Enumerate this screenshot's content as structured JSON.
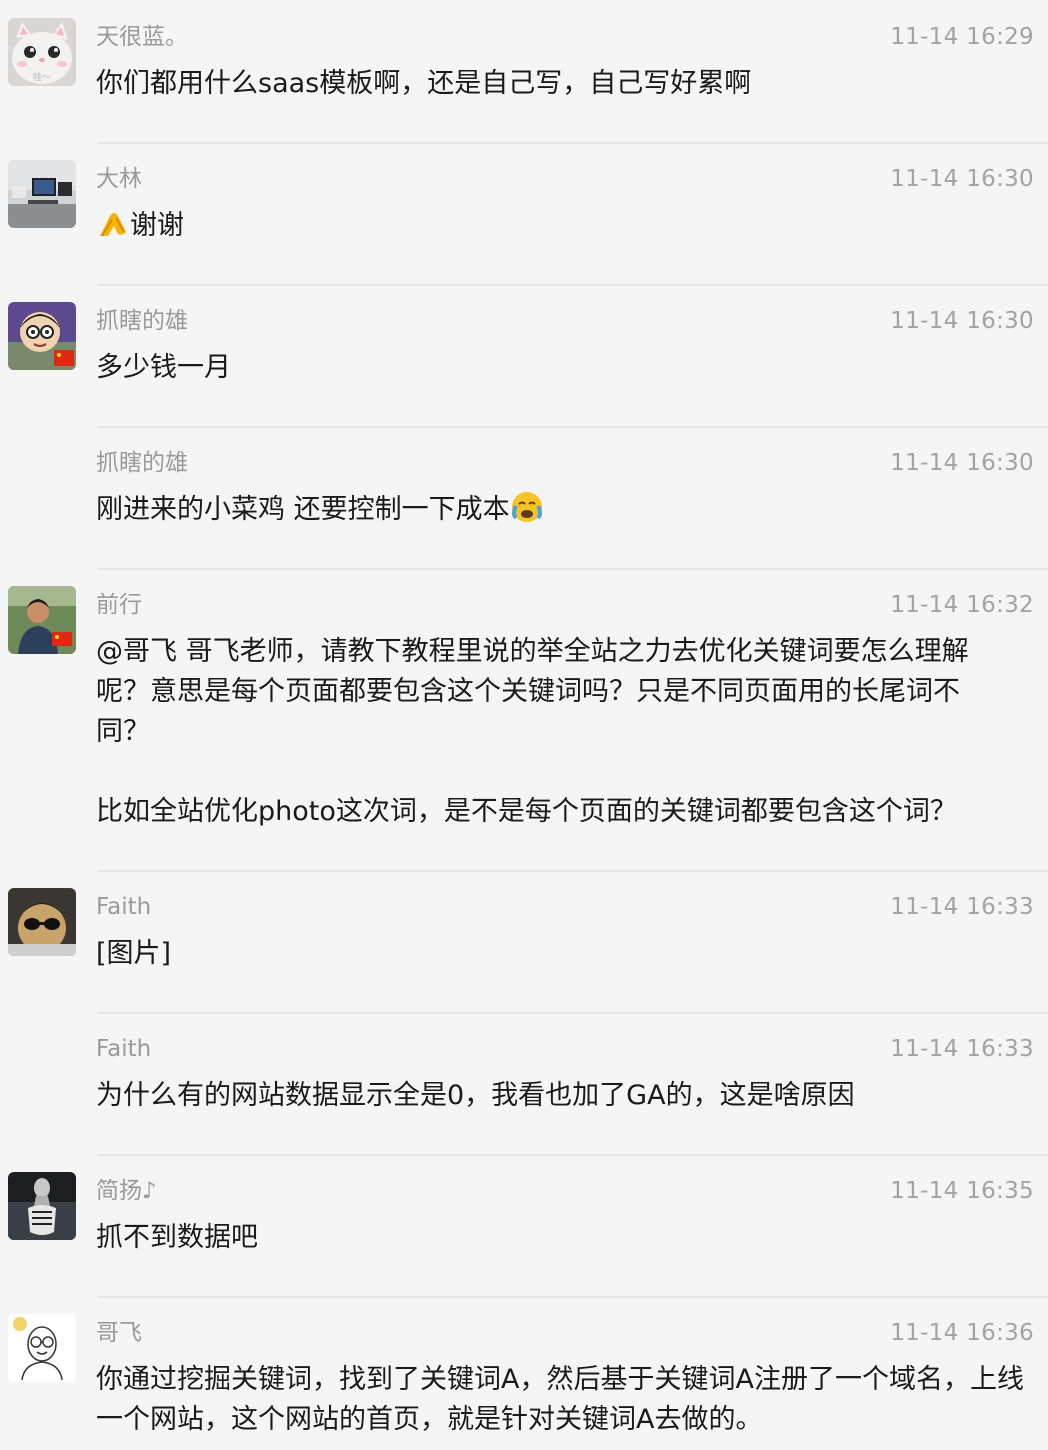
{
  "messages": [
    {
      "name": "天很蓝。",
      "time": "11-14 16:29",
      "text": "你们都用什么saas模板啊，还是自己写，自己写好累啊",
      "avatar_label": "哇～"
    },
    {
      "name": "大林",
      "time": "11-14 16:30",
      "text": "谢谢",
      "emoji": "hands-together-emoji"
    },
    {
      "name": "抓瞎的雄",
      "time": "11-14 16:30",
      "text": "多少钱一月"
    },
    {
      "name": "抓瞎的雄",
      "time": "11-14 16:30",
      "text": "刚进来的小菜鸡 还要控制一下成本",
      "emoji": "crying-face-emoji"
    },
    {
      "name": "前行",
      "time": "11-14 16:32",
      "text": "@哥飞 哥飞老师，请教下教程里说的举全站之力去优化关键词要怎么理解呢？意思是每个页面都要包含这个关键词吗？只是不同页面用的长尾词不同？\n\n比如全站优化photo这次词，是不是每个页面的关键词都要包含这个词？"
    },
    {
      "name": "Faith",
      "time": "11-14 16:33",
      "text": "[图片]"
    },
    {
      "name": "Faith",
      "time": "11-14 16:33",
      "text": "为什么有的网站数据显示全是0，我看也加了GA的，这是啥原因"
    },
    {
      "name": "简扬♪",
      "time": "11-14 16:35",
      "text": "抓不到数据吧"
    },
    {
      "name": "哥飞",
      "time": "11-14 16:36",
      "text": "你通过挖掘关键词，找到了关键词A，然后基于关键词A注册了一个域名，上线一个网站，这个网站的首页，就是针对关键词A去做的。"
    }
  ],
  "colors": {
    "background": "#f5f5f5",
    "name": "#9a9a9a",
    "time": "#a3a3a3",
    "text": "#1a1a1a",
    "divider": "#e6e6e6"
  }
}
